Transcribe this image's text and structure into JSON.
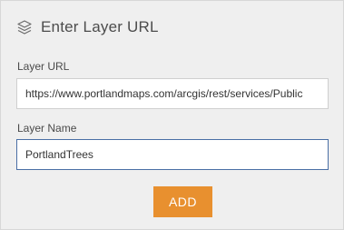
{
  "header": {
    "title": "Enter Layer URL",
    "icon": "layers-icon"
  },
  "form": {
    "url_label": "Layer URL",
    "url_value": "https://www.portlandmaps.com/arcgis/rest/services/Public",
    "name_label": "Layer Name",
    "name_value": "PortlandTrees"
  },
  "actions": {
    "add_label": "ADD"
  },
  "colors": {
    "accent": "#e8902f",
    "panel_bg": "#efefef",
    "focus_border": "#4a6fa5"
  }
}
